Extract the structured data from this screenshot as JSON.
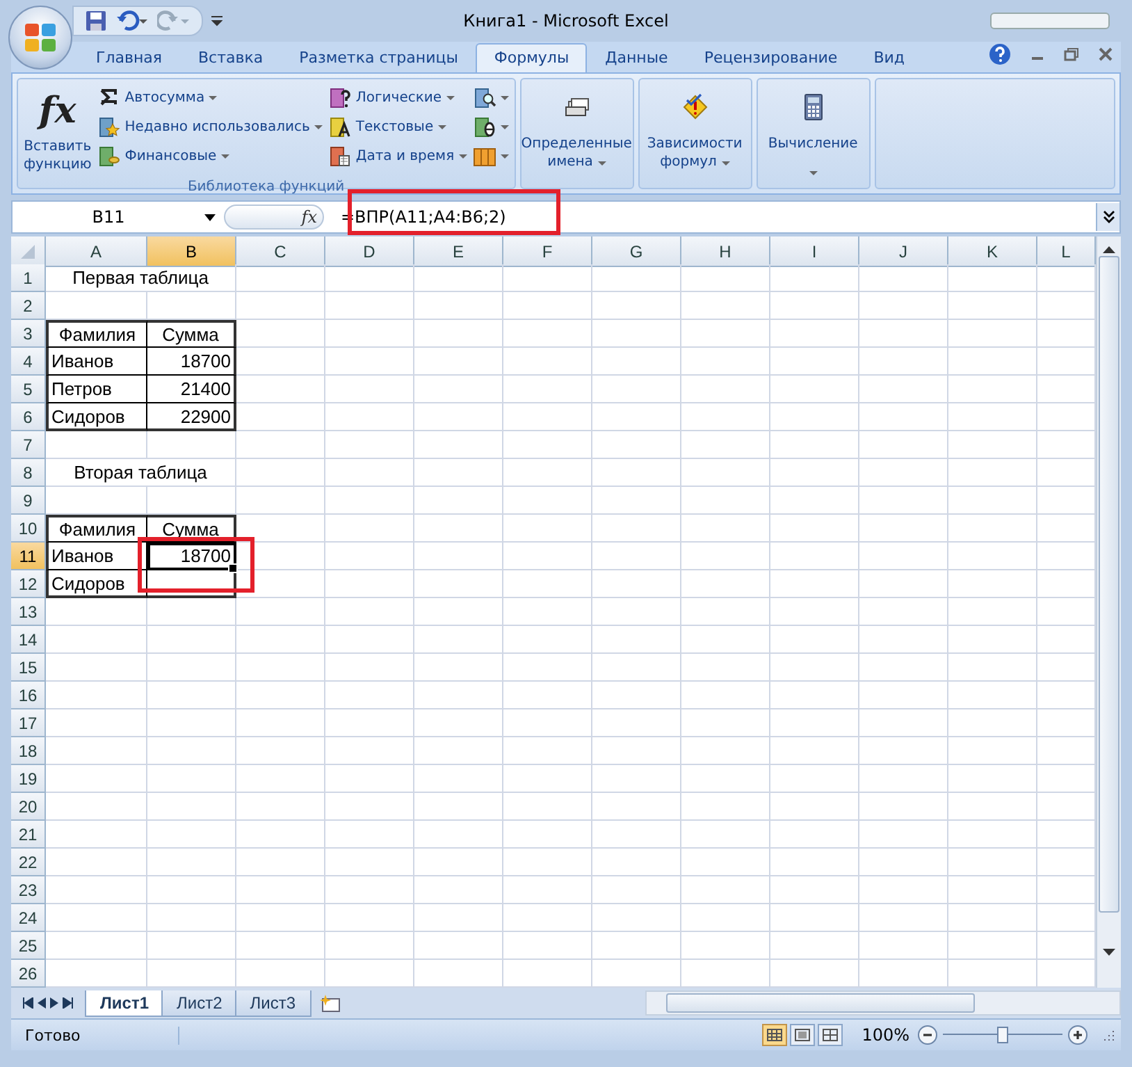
{
  "title_bar": {
    "title": "Книга1 - Microsoft Excel"
  },
  "ribbon_tabs": [
    {
      "label": "Главная",
      "selected": false
    },
    {
      "label": "Вставка",
      "selected": false
    },
    {
      "label": "Разметка страницы",
      "selected": false
    },
    {
      "label": "Формулы",
      "selected": true
    },
    {
      "label": "Данные",
      "selected": false
    },
    {
      "label": "Рецензирование",
      "selected": false
    },
    {
      "label": "Вид",
      "selected": false
    }
  ],
  "function_library": {
    "label": "Библиотека функций",
    "insert_button": {
      "icon_text": "fx",
      "lines": [
        "Вставить",
        "функцию"
      ]
    },
    "columns": [
      [
        {
          "label": "Автосумма"
        },
        {
          "label": "Недавно использовались"
        },
        {
          "label": "Финансовые"
        }
      ],
      [
        {
          "label": "Логические"
        },
        {
          "label": "Текстовые"
        },
        {
          "label": "Дата и время"
        }
      ]
    ]
  },
  "ribbon_buttons": [
    {
      "lines": [
        "Определенные",
        "имена"
      ]
    },
    {
      "lines": [
        "Зависимости",
        "формул"
      ]
    },
    {
      "lines": [
        "Вычисление"
      ]
    }
  ],
  "formula_bar": {
    "name_box": "B11",
    "fx": "fx",
    "formula": "=ВПР(A11;A4:B6;2)"
  },
  "sheet": {
    "columns": [
      {
        "label": "A",
        "selected": false
      },
      {
        "label": "B",
        "selected": true
      },
      {
        "label": "C",
        "selected": false
      },
      {
        "label": "D",
        "selected": false
      },
      {
        "label": "E",
        "selected": false
      },
      {
        "label": "F",
        "selected": false
      },
      {
        "label": "G",
        "selected": false
      },
      {
        "label": "H",
        "selected": false
      },
      {
        "label": "I",
        "selected": false
      },
      {
        "label": "J",
        "selected": false
      },
      {
        "label": "K",
        "selected": false
      },
      {
        "label": "L",
        "selected": false
      }
    ],
    "rows": [
      {
        "number": "1",
        "selected": false,
        "title": "Первая таблица"
      },
      {
        "number": "2",
        "selected": false
      },
      {
        "number": "3",
        "selected": false,
        "cells": [
          {
            "text": "Фамилия",
            "selected": false
          },
          {
            "text": "Сумма",
            "selected": false
          }
        ]
      },
      {
        "number": "4",
        "selected": false,
        "cells": [
          {
            "text": "Иванов",
            "selected": false
          },
          {
            "text": "18700",
            "selected": false
          }
        ]
      },
      {
        "number": "5",
        "selected": false,
        "cells": [
          {
            "text": "Петров",
            "selected": false
          },
          {
            "text": "21400",
            "selected": false
          }
        ]
      },
      {
        "number": "6",
        "selected": false,
        "cells": [
          {
            "text": "Сидоров",
            "selected": false
          },
          {
            "text": "22900",
            "selected": false
          }
        ]
      },
      {
        "number": "7",
        "selected": false
      },
      {
        "number": "8",
        "selected": false,
        "title": "Вторая таблица"
      },
      {
        "number": "9",
        "selected": false
      },
      {
        "number": "10",
        "selected": false,
        "cells": [
          {
            "text": "Фамилия",
            "selected": false
          },
          {
            "text": "Сумма",
            "selected": false
          }
        ]
      },
      {
        "number": "11",
        "selected": true,
        "cells": [
          {
            "text": "Иванов",
            "selected": false
          },
          {
            "text": "18700",
            "selected": true
          }
        ]
      },
      {
        "number": "12",
        "selected": false,
        "cells": [
          {
            "text": "Сидоров",
            "selected": false
          },
          {
            "selected": false
          }
        ]
      },
      {
        "number": "13",
        "selected": false
      },
      {
        "number": "14",
        "selected": false
      },
      {
        "number": "15",
        "selected": false
      },
      {
        "number": "16",
        "selected": false
      },
      {
        "number": "17",
        "selected": false
      },
      {
        "number": "18",
        "selected": false
      },
      {
        "number": "19",
        "selected": false
      },
      {
        "number": "20",
        "selected": false
      },
      {
        "number": "21",
        "selected": false
      },
      {
        "number": "22",
        "selected": false
      },
      {
        "number": "23",
        "selected": false
      },
      {
        "number": "24",
        "selected": false
      },
      {
        "number": "25",
        "selected": false
      },
      {
        "number": "26",
        "selected": false
      }
    ]
  },
  "sheet_tabs": [
    {
      "label": "Лист1",
      "selected": true
    },
    {
      "label": "Лист2",
      "selected": false
    },
    {
      "label": "Лист3",
      "selected": false
    }
  ],
  "status_bar": {
    "status": "Готово",
    "views": [
      {
        "kind": "normal",
        "selected": true
      },
      {
        "kind": "layout",
        "selected": false
      },
      {
        "kind": "pagebreak",
        "selected": false
      }
    ],
    "zoom": "100%",
    "zoom_slider": {
      "level": 0.5
    }
  }
}
